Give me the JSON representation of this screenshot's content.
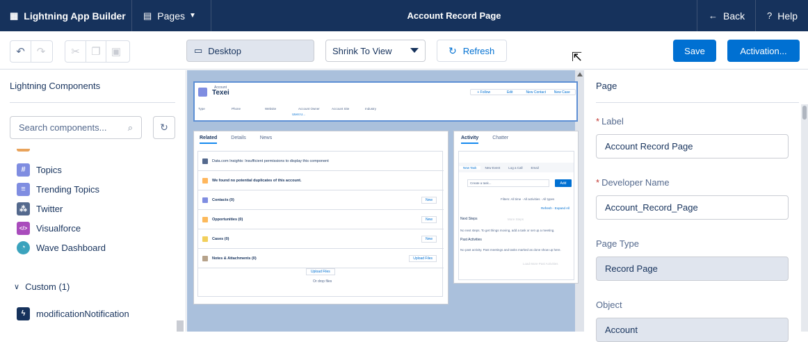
{
  "topbar": {
    "app_name": "Lightning App Builder",
    "pages_label": "Pages",
    "page_title": "Account Record Page",
    "back_label": "Back",
    "help_label": "Help"
  },
  "toolbar": {
    "view_mode": "Desktop",
    "zoom_option": "Shrink To View",
    "refresh_label": "Refresh",
    "save_label": "Save",
    "activation_label": "Activation..."
  },
  "left_panel": {
    "title": "Lightning Components",
    "search_placeholder": "Search components...",
    "items": [
      {
        "label": "Topics",
        "icon": "hash-icon",
        "color": "#7f8de1"
      },
      {
        "label": "Trending Topics",
        "icon": "list-icon",
        "color": "#7f8de1"
      },
      {
        "label": "Twitter",
        "icon": "network-icon",
        "color": "#54698d"
      },
      {
        "label": "Visualforce",
        "icon": "code-icon",
        "color": "#a94cbc"
      },
      {
        "label": "Wave Dashboard",
        "icon": "wave-icon",
        "color": "#3ba3bd"
      }
    ],
    "custom_section": "Custom (1)",
    "custom_items": [
      {
        "label": "modificationNotification",
        "icon": "lightning-icon",
        "color": "#16325c"
      }
    ]
  },
  "canvas": {
    "record_type": "Account",
    "record_name": "Texei",
    "header_actions": [
      "+ Follow",
      "Edit",
      "New Contact",
      "New Case"
    ],
    "header_fields": [
      "Type",
      "Phone",
      "Website",
      "Account Owner",
      "Account Site",
      "Industry"
    ],
    "owner_value": "Utent U...",
    "main_tabs": [
      "Related",
      "Details",
      "News"
    ],
    "related_rows": [
      {
        "label": "Data.com Insights: Insufficient permissions to display this component",
        "color": "#54698d",
        "new": false
      },
      {
        "label": "We found no potential duplicates of this account.",
        "color": "#ffb75d",
        "new": false
      },
      {
        "label": "Contacts (0)",
        "color": "#7f8de1",
        "new": true
      },
      {
        "label": "Opportunities (0)",
        "color": "#fcb95b",
        "new": true
      },
      {
        "label": "Cases (0)",
        "color": "#f2cf5b",
        "new": true
      },
      {
        "label": "Notes & Attachments (0)",
        "color": "#b6a28a",
        "new": true
      }
    ],
    "new_label": "New",
    "upload_files_button": "Upload Files",
    "upload_new_label": "Upload Files",
    "drop_files": "Or drop files",
    "side_tabs": [
      "Activity",
      "Chatter"
    ],
    "activity_subtabs": [
      "New Task",
      "New Event",
      "Log a Call",
      "Email"
    ],
    "create_task": "Create a task...",
    "add_label": "Add",
    "filters": "Filters: All time · All activities · All types",
    "refresh_expand": "Refresh · Expand All",
    "next_steps": "Next Steps",
    "more_steps": "More Steps",
    "no_next": "No next steps. To get things moving, add a task or set up a meeting.",
    "past_activities": "Past Activities",
    "no_past": "No past activity. Past meetings and tasks marked as done show up here.",
    "load_more": "Load More Past Activities"
  },
  "right_panel": {
    "title": "Page",
    "label_field_label": "Label",
    "label_value": "Account Record Page",
    "dev_name_label": "Developer Name",
    "dev_name_value": "Account_Record_Page",
    "page_type_label": "Page Type",
    "page_type_value": "Record Page",
    "object_label": "Object",
    "object_value": "Account"
  }
}
